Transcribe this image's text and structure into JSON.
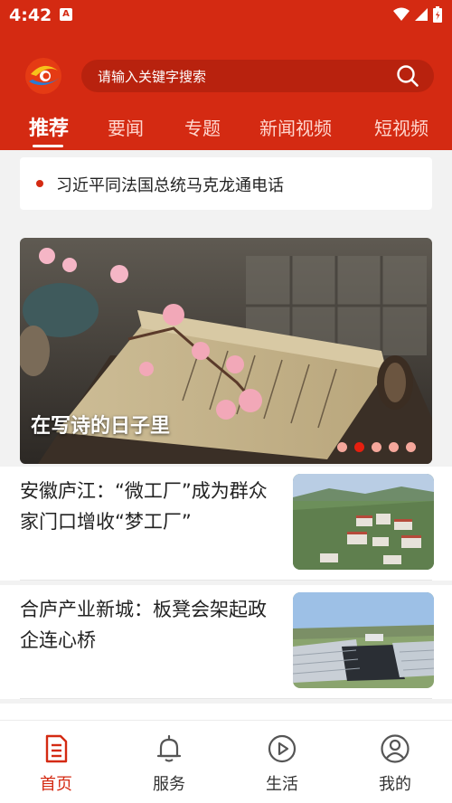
{
  "status_bar": {
    "time": "4:42",
    "notification_icon": "A"
  },
  "search": {
    "placeholder": "请输入关键字搜索"
  },
  "tabs": [
    {
      "label": "推荐",
      "active": true
    },
    {
      "label": "要闻",
      "active": false
    },
    {
      "label": "专题",
      "active": false
    },
    {
      "label": "新闻视频",
      "active": false
    },
    {
      "label": "短视频",
      "active": false
    }
  ],
  "ticker": {
    "text": "习近平同法国总统马克龙通电话"
  },
  "banner": {
    "title": "在写诗的日子里",
    "dots_total": 5,
    "active_dot": 2
  },
  "news": [
    {
      "title": "安徽庐江：“微工厂”成为群众家门口增收“梦工厂”"
    },
    {
      "title": "合庐产业新城：板凳会架起政企连心桥"
    }
  ],
  "bottom_nav": [
    {
      "label": "首页",
      "icon": "document-icon",
      "active": true
    },
    {
      "label": "服务",
      "icon": "bell-icon",
      "active": false
    },
    {
      "label": "生活",
      "icon": "play-circle-icon",
      "active": false
    },
    {
      "label": "我的",
      "icon": "user-icon",
      "active": false
    }
  ],
  "colors": {
    "brand_red": "#d42a12",
    "search_bg": "#b8220e",
    "dot_active": "#e51f0f",
    "dot_inactive": "#f5a79b"
  }
}
